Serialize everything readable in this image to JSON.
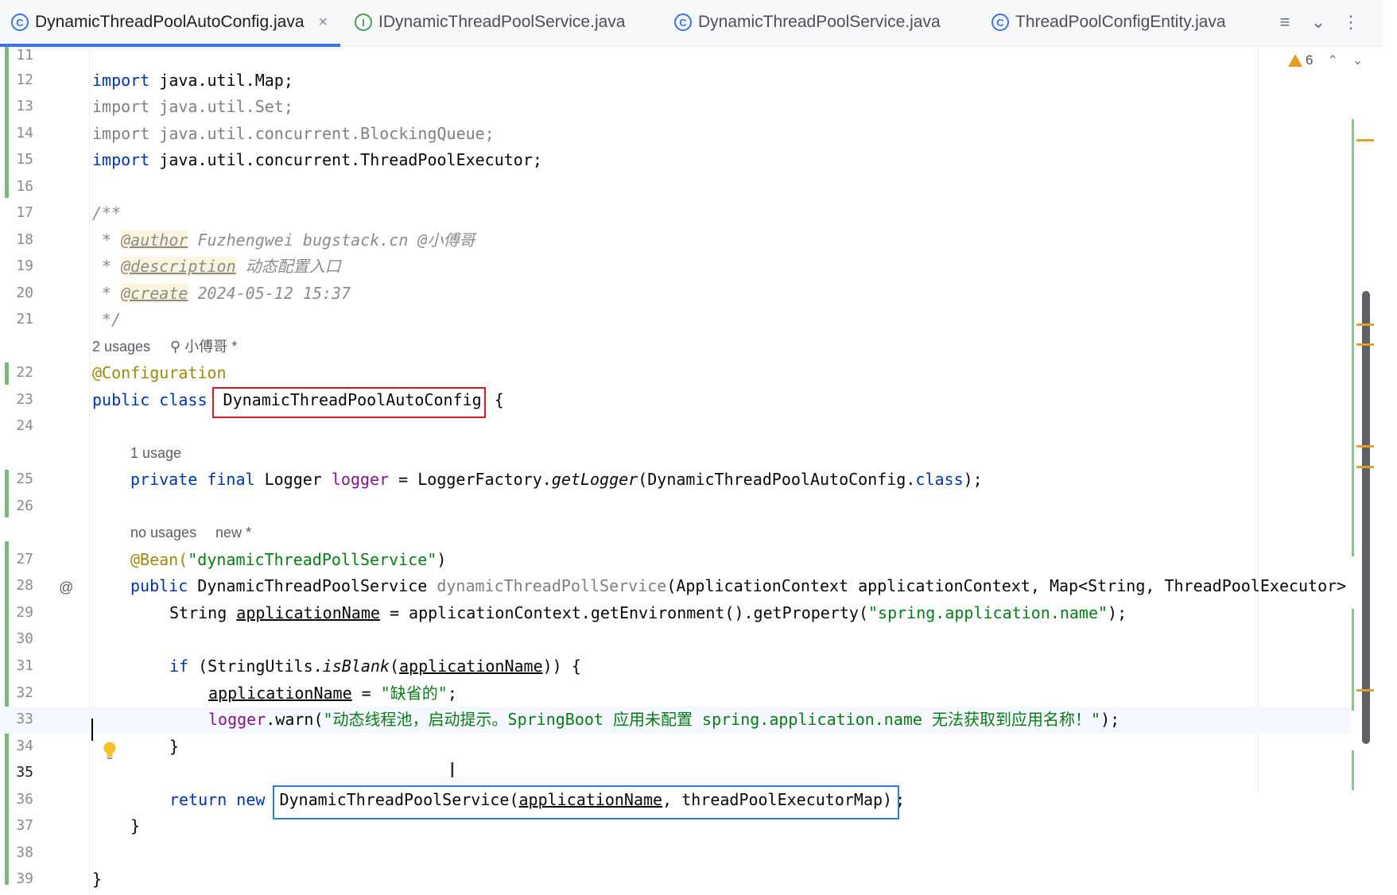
{
  "tabs": [
    {
      "label": "DynamicThreadPoolAutoConfig.java",
      "icon": "C",
      "active": true,
      "close": "×"
    },
    {
      "label": "IDynamicThreadPoolService.java",
      "icon": "I",
      "active": false
    },
    {
      "label": "DynamicThreadPoolService.java",
      "icon": "C",
      "active": false
    },
    {
      "label": "ThreadPoolConfigEntity.java",
      "icon": "C",
      "active": false
    }
  ],
  "toolbar": {
    "list_icon": "≡",
    "dropdown_icon": "⌄",
    "more_icon": "⋮"
  },
  "inspections": {
    "warning_count": "6",
    "up": "⌃",
    "down": "⌄"
  },
  "line_numbers": [
    "11",
    "12",
    "13",
    "14",
    "15",
    "16",
    "17",
    "18",
    "19",
    "20",
    "21",
    "22",
    "23",
    "24",
    "25",
    "26",
    "27",
    "28",
    "29",
    "30",
    "31",
    "32",
    "33",
    "34",
    "35",
    "36",
    "37",
    "38",
    "39"
  ],
  "code": {
    "l12": {
      "kw": "import",
      "rest": " java.util.Map;"
    },
    "l13": {
      "kw": "import",
      "rest": " java.util.Set;"
    },
    "l14": {
      "kw": "import",
      "rest": " java.util.concurrent.BlockingQueue;"
    },
    "l15": {
      "kw": "import",
      "rest": " java.util.concurrent.ThreadPoolExecutor;"
    },
    "l17": "/**",
    "l18": {
      "pre": " * ",
      "tag": "@author",
      "rest": " Fuzhengwei bugstack.cn @小傅哥"
    },
    "l19": {
      "pre": " * ",
      "tag": "@description",
      "rest": " 动态配置入口"
    },
    "l20": {
      "pre": " * ",
      "tag": "@create",
      "rest": " 2024-05-12 15:37"
    },
    "l21": " */",
    "hint_class": {
      "usages": "2 usages",
      "author": "小傅哥 *"
    },
    "l22": "@Configuration",
    "l23": {
      "kw": "public class ",
      "name": "DynamicThreadPoolAutoConfig",
      "rest": " {"
    },
    "hint_logger": "1 usage",
    "l25": {
      "kw": "private final ",
      "type": "Logger ",
      "field": "logger",
      "mid": " = LoggerFactory.",
      "method": "getLogger",
      "arg": "(DynamicThreadPoolAutoConfig.",
      "cls": "class",
      "end": ");"
    },
    "hint_bean": {
      "usages": "no usages",
      "author": "new *"
    },
    "l27": {
      "ann": "@Bean(",
      "str": "\"dynamicThreadPollService\"",
      "end": ")"
    },
    "l28": {
      "kw": "public ",
      "type": "DynamicThreadPoolService ",
      "method": "dynamicThreadPollService",
      "params": "(ApplicationContext applicationContext, Map<String, ThreadPoolExecutor>"
    },
    "l29": {
      "type": "String ",
      "var": "applicationName",
      "mid": " = applicationContext.getEnvironment().getProperty(",
      "str": "\"spring.application.name\"",
      "end": ");"
    },
    "l31": {
      "kw": "if ",
      "a": "(StringUtils.",
      "m": "isBlank",
      "b": "(",
      "var": "applicationName",
      "c": ")) {"
    },
    "l32": {
      "var": "applicationName",
      "mid": " = ",
      "str": "\"缺省的\"",
      "end": ";"
    },
    "l33": {
      "field": "logger",
      "mid": ".warn(",
      "str": "\"动态线程池，启动提示。SpringBoot 应用未配置 spring.application.name 无法获取到应用名称！\"",
      "end": ");"
    },
    "l34": "}",
    "l36": {
      "kw": "return new ",
      "a": "DynamicThreadPoolService(",
      "var": "applicationName",
      "b": ", threadPoolExecutorMap)",
      "end": ";"
    },
    "l37": "}",
    "l39": "}"
  },
  "gutter": {
    "bean_icon": "@",
    "cursor_glyph": "I"
  },
  "colors": {
    "keyword": "#0033b3",
    "string": "#067d17",
    "annotation": "#9e880d",
    "comment": "#8c8c8c",
    "field": "#871094",
    "highlight_red": "#e0181b",
    "highlight_blue": "#2a7fe0",
    "vcs_added": "#79b97b"
  }
}
